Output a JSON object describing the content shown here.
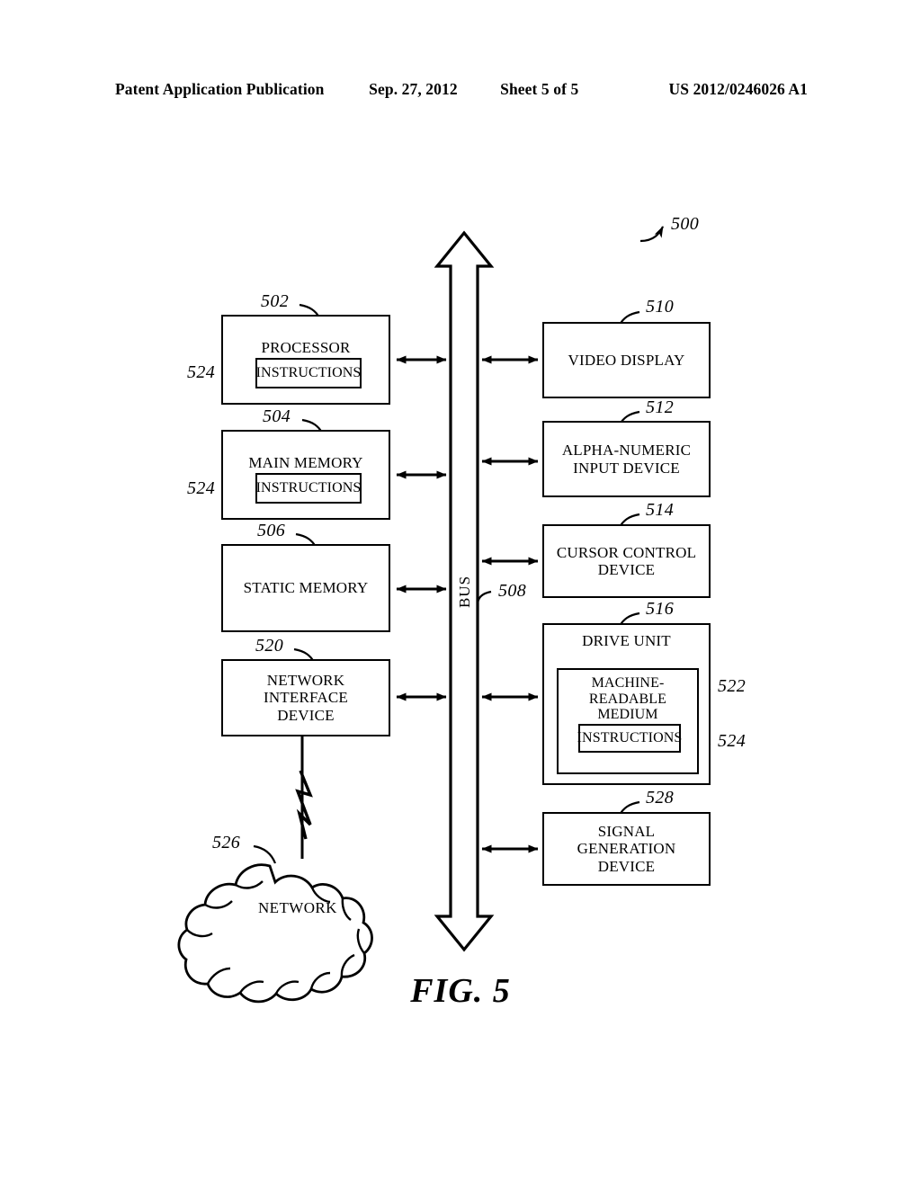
{
  "header": {
    "publication": "Patent Application Publication",
    "date": "Sep. 27, 2012",
    "sheet": "Sheet 5 of 5",
    "patent_number": "US 2012/0246026 A1"
  },
  "figure": {
    "caption": "FIG. 5",
    "system_ref": "500",
    "bus": {
      "label": "BUS",
      "ref": "508"
    },
    "left_column": [
      {
        "id": "processor",
        "label": "PROCESSOR",
        "ref": "502",
        "inner": {
          "id": "processor-instructions",
          "label": "INSTRUCTIONS",
          "ref": "524"
        }
      },
      {
        "id": "main-memory",
        "label": "MAIN MEMORY",
        "ref": "504",
        "inner": {
          "id": "main-memory-instructions",
          "label": "INSTRUCTIONS",
          "ref": "524"
        }
      },
      {
        "id": "static-memory",
        "label": "STATIC MEMORY",
        "ref": "506"
      },
      {
        "id": "network-interface-device",
        "label": "NETWORK\nINTERFACE\nDEVICE",
        "ref": "520"
      }
    ],
    "right_column": [
      {
        "id": "video-display",
        "label": "VIDEO DISPLAY",
        "ref": "510"
      },
      {
        "id": "alpha-numeric-input-device",
        "label": "ALPHA-NUMERIC\nINPUT DEVICE",
        "ref": "512"
      },
      {
        "id": "cursor-control-device",
        "label": "CURSOR CONTROL\nDEVICE",
        "ref": "514"
      },
      {
        "id": "drive-unit",
        "label": "DRIVE UNIT",
        "ref": "516",
        "inner": {
          "id": "machine-readable-medium",
          "label": "MACHINE-READABLE\nMEDIUM",
          "ref": "522",
          "inner": {
            "id": "drive-instructions",
            "label": "INSTRUCTIONS",
            "ref": "524"
          }
        }
      },
      {
        "id": "signal-generation-device",
        "label": "SIGNAL\nGENERATION\nDEVICE",
        "ref": "528"
      }
    ],
    "network": {
      "label": "NETWORK",
      "ref": "526"
    }
  },
  "colors": {
    "ink": "#000000",
    "paper": "#ffffff"
  }
}
